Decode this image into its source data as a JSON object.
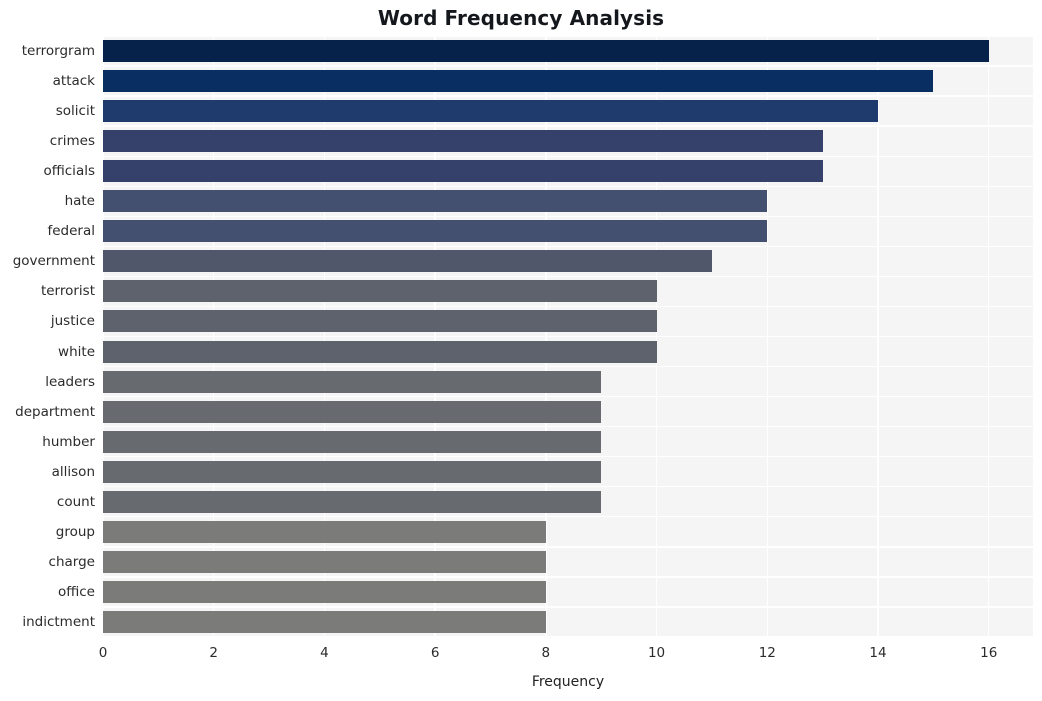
{
  "chart_data": {
    "type": "bar",
    "orientation": "horizontal",
    "title": "Word Frequency Analysis",
    "xlabel": "Frequency",
    "ylabel": "",
    "xlim": [
      0,
      16.8
    ],
    "ylim": [
      0,
      20
    ],
    "grid": true,
    "legend": false,
    "xticks": [
      0,
      2,
      4,
      6,
      8,
      10,
      12,
      14,
      16
    ],
    "xtick_labels": [
      "0",
      "2",
      "4",
      "6",
      "8",
      "10",
      "12",
      "14",
      "16"
    ],
    "categories": [
      "terrorgram",
      "attack",
      "solicit",
      "crimes",
      "officials",
      "hate",
      "federal",
      "government",
      "terrorist",
      "justice",
      "white",
      "leaders",
      "department",
      "humber",
      "allison",
      "count",
      "group",
      "charge",
      "office",
      "indictment"
    ],
    "values": [
      16,
      15,
      14,
      13,
      13,
      12,
      12,
      11,
      10,
      10,
      10,
      9,
      9,
      9,
      9,
      9,
      8,
      8,
      8,
      8
    ],
    "bar_colors": [
      "#06224b",
      "#092f62",
      "#1f3a6d",
      "#35406b",
      "#35406b",
      "#44506f",
      "#44506f",
      "#51576b",
      "#5e626c",
      "#5e626c",
      "#5e626c",
      "#676a6f",
      "#676a6f",
      "#676a6f",
      "#676a6f",
      "#676a6f",
      "#7b7b79",
      "#7b7b79",
      "#7b7b79",
      "#7b7b79"
    ],
    "plot_background": "#f5f5f5",
    "grid_color": "#ffffff",
    "figure_background": "#ffffff",
    "title_color": "#14171c",
    "tick_color": "#2b2b2b"
  }
}
